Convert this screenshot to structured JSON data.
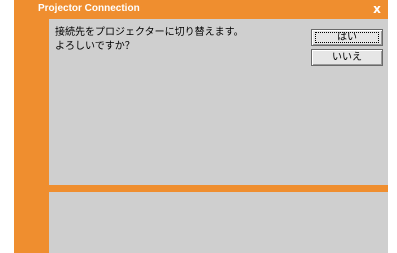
{
  "window": {
    "title": "Projector Connection",
    "close_label": "x"
  },
  "dialog": {
    "message_line1": "接続先をプロジェクターに切り替えます。",
    "message_line2": "よろしいですか？",
    "yes_label": "はい",
    "no_label": "いいえ"
  },
  "colors": {
    "accent": "#ef8e2f",
    "panel": "#cfcfcf"
  }
}
